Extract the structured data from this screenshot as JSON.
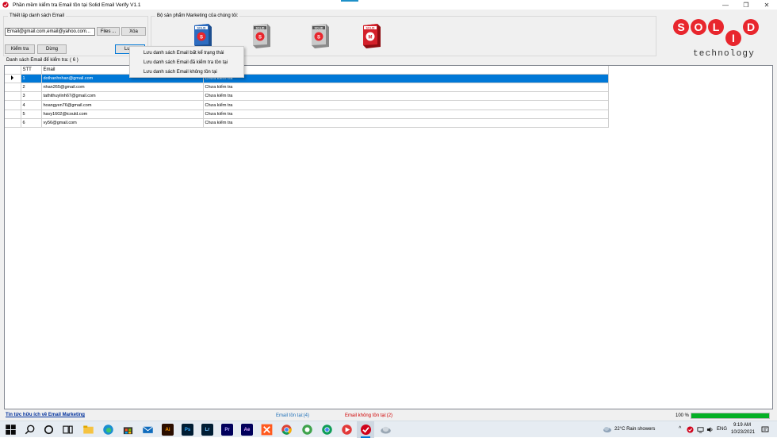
{
  "window": {
    "title": "Phần mềm kiểm tra Email tồn tại Solid Email Verify V1.1",
    "minimize_glyph": "—",
    "restore_glyph": "❐",
    "close_glyph": "✕"
  },
  "setup": {
    "group_label": "Thiết lập danh sách Email",
    "email_input_value": "Email@gmail.com,email@yahoo.com...",
    "files_label": "Files ...",
    "delete_label": "Xóa",
    "check_label": "Kiểm tra",
    "stop_label": "Dừng",
    "save_label": "Lưu"
  },
  "products": {
    "group_label": "Bộ sản phẩm Marketing của chúng tôi:",
    "items": [
      {
        "icon": "solid-product-box-blue-icon",
        "text": "SOLID"
      },
      {
        "icon": "solid-product-box-silver-icon",
        "text": "SOLID"
      },
      {
        "icon": "solid-product-box-silver-icon",
        "text": "SOLID"
      },
      {
        "icon": "solid-product-box-red-icon",
        "text": "SOLID"
      }
    ]
  },
  "logo": {
    "text_top": "SOLID",
    "text_bottom": "technology",
    "color_red": "#e8262d"
  },
  "list": {
    "label": "Danh sách Email để kiểm tra: ( 6 )",
    "columns": [
      "STT",
      "Email",
      ""
    ],
    "rows": [
      {
        "stt": "1",
        "email": "dothanhnhan@gmail.com",
        "status": "Chưa kiểm tra"
      },
      {
        "stt": "2",
        "email": "nhan265@gmail.com",
        "status": "Chưa kiểm tra"
      },
      {
        "stt": "3",
        "email": "tathithuylinh67@gmail.com",
        "status": "Chưa kiểm tra"
      },
      {
        "stt": "4",
        "email": "hoangyen76@gmail.com",
        "status": "Chưa kiểm tra"
      },
      {
        "stt": "5",
        "email": "havy1602@icould.com",
        "status": "Chưa kiểm tra"
      },
      {
        "stt": "6",
        "email": "vy56@gmail.com",
        "status": "Chưa kiểm tra"
      }
    ],
    "selected_row": 1
  },
  "context_menu": {
    "items": [
      "Lưu danh sách Email bất kể trạng thái",
      "Lưu danh sách Email đã kiểm tra tồn tại",
      "Lưu danh sách Email không tồn tại"
    ]
  },
  "statusbar": {
    "link": "Tin tức hữu ích về Email Marketing",
    "exist": "Email tồn tại:(4)",
    "not_exist": "Email không tồn tại:(2)",
    "percent": "100 %",
    "progress": 1.0,
    "accent_exist": "#1e6fb7",
    "accent_not_exist": "#d00000",
    "progress_color": "#06b025"
  },
  "taskbar": {
    "apps": [
      "start-icon",
      "search-icon",
      "cortana-icon",
      "task-view-icon",
      "file-explorer-icon",
      "edge-icon",
      "store-icon",
      "mail-icon",
      "illustrator-icon",
      "photoshop-icon",
      "lightroom-icon",
      "premiere-icon",
      "after-effects-icon",
      "app-x-icon",
      "chrome-icon",
      "coccoc-icon",
      "chrome-alt-icon",
      "media-icon",
      "solid-verify-icon",
      "cloud-app-icon"
    ],
    "app_labels": {
      "ai": "Ai",
      "ps": "Ps",
      "lr": "Lr",
      "pr": "Pr",
      "ae": "Ae"
    },
    "weather": "22°C  Rain showers",
    "lang": "ENG",
    "time": "9:19 AM",
    "date": "10/23/2021"
  }
}
